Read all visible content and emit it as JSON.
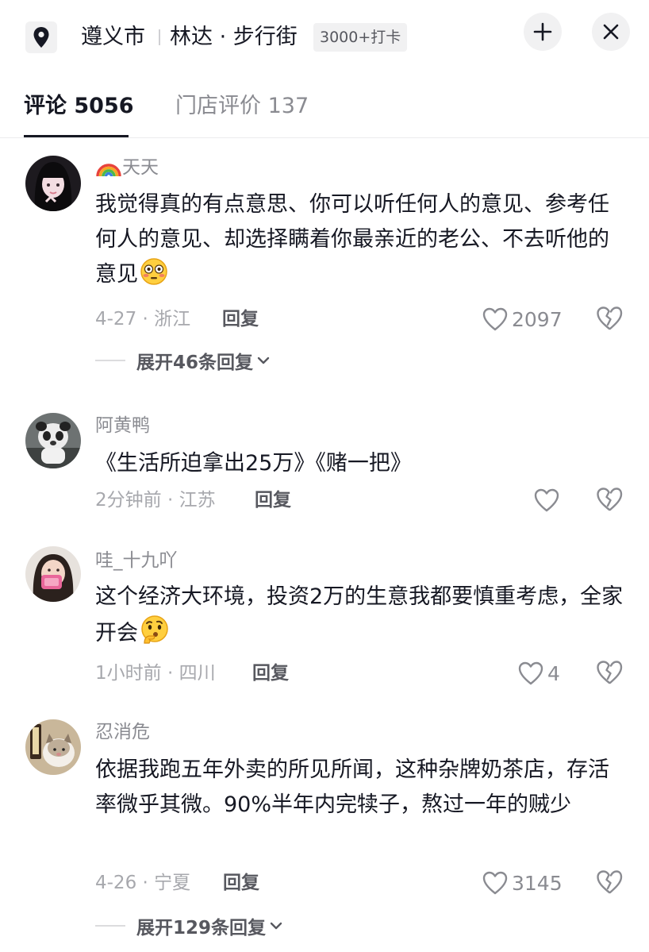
{
  "header": {
    "city": "遵义市",
    "place": "林达 · 步行街",
    "badge": "3000+打卡"
  },
  "tabs": [
    {
      "label": "评论 5056",
      "active": true
    },
    {
      "label": "门店评价 137",
      "active": false
    }
  ],
  "comments": [
    {
      "user": "天天",
      "text": "我觉得真的有点意思、你可以听任何人的意见、参考任何人的意见、却选择瞒着你最亲近的老公、不去听他的意见",
      "meta": "4-27 · 浙江",
      "reply": "回复",
      "likes": "2097",
      "expand": "展开46条回复"
    },
    {
      "user": "阿黄鸭",
      "text": "《生活所迫拿出25万》《赌一把》",
      "meta": "2分钟前 · 江苏",
      "reply": "回复",
      "likes": ""
    },
    {
      "user": "哇_十九吖",
      "text": "这个经济大环境，投资2万的生意我都要慎重考虑，全家开会",
      "meta": "1小时前 · 四川",
      "reply": "回复",
      "likes": "4"
    },
    {
      "user": "忍消危",
      "text": "依据我跑五年外卖的所见所闻，这种杂牌奶茶店，存活率微乎其微。90%半年内完犊子，熬过一年的贼少",
      "meta": "4-26 · 宁夏",
      "reply": "回复",
      "likes": "3145",
      "expand": "展开129条回复"
    }
  ],
  "icons": {
    "location": "location-pin-icon",
    "collapse": "collapse-icon",
    "close": "close-icon",
    "like": "heart-icon",
    "dislike": "broken-heart-icon",
    "chevron": "chevron-down-icon"
  }
}
